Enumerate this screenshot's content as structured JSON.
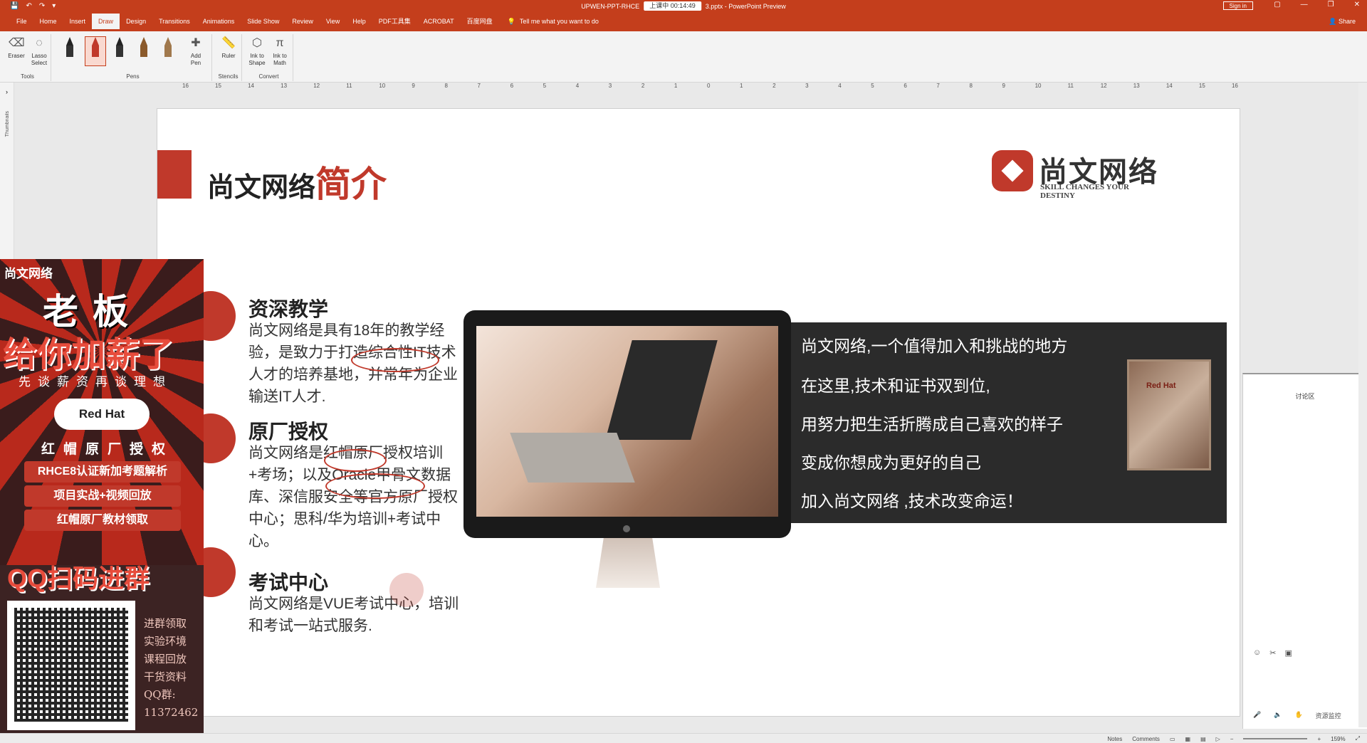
{
  "titlebar": {
    "title_left": "UPWEN-PPT-RHCE",
    "timer": "上课中 00:14:49",
    "title_right": "3.pptx - PowerPoint Preview",
    "signin": "Sign in"
  },
  "menu": {
    "tabs": [
      "File",
      "Home",
      "Insert",
      "Draw",
      "Design",
      "Transitions",
      "Animations",
      "Slide Show",
      "Review",
      "View",
      "Help",
      "PDF工具集",
      "ACROBAT",
      "百度网盘"
    ],
    "active": "Draw",
    "tellme": "Tell me what you want to do",
    "share": "Share"
  },
  "ribbon": {
    "eraser": "Eraser",
    "lasso": "Lasso Select",
    "tools_group": "Tools",
    "add_pen": "Add Pen",
    "pens_group": "Pens",
    "ruler": "Ruler",
    "stencils_group": "Stencils",
    "ink_shape": "Ink to Shape",
    "ink_math": "Ink to Math",
    "convert_group": "Convert"
  },
  "ruler": {
    "ticks": [
      "16",
      "15",
      "14",
      "13",
      "12",
      "11",
      "10",
      "9",
      "8",
      "7",
      "6",
      "5",
      "4",
      "3",
      "2",
      "1",
      "0",
      "1",
      "2",
      "3",
      "4",
      "5",
      "6",
      "7",
      "8",
      "9",
      "10",
      "11",
      "12",
      "13",
      "14",
      "15",
      "16"
    ]
  },
  "thumbnails_label": "Thumbnails",
  "slide": {
    "title_main": "尚文网络",
    "title_highlight": "简介",
    "logo_name": "尚文网络",
    "logo_sub": "SKILL CHANGES YOUR DESTINY",
    "sections": [
      {
        "title": "资深教学",
        "body": "尚文网络是具有18年的教学经验，是致力于打造综合性IT技术人才的培养基地，并常年为企业输送IT人才."
      },
      {
        "title": "原厂授权",
        "body": "尚文网络是红帽原厂授权培训+考场；以及Oracle甲骨文数据库、深信服安全等官方原厂授权中心；思科/华为培训+考试中心。"
      },
      {
        "title": "考试中心",
        "body": "尚文网络是VUE考试中心，培训和考试一站式服务."
      }
    ],
    "panel_lines": [
      "尚文网络,一个值得加入和挑战的地方",
      "在这里,技术和证书双到位,",
      "用努力把生活折腾成自己喜欢的样子",
      "变成你想成为更好的自己",
      "加入尚文网络 ,技术改变命运！"
    ],
    "plaque_text": "Red Hat"
  },
  "ad": {
    "brand": "尚文网络",
    "big1": "老板",
    "big2": "给你加薪了",
    "tag1": "先谈薪资再谈理想",
    "redhat": "Red Hat",
    "tag2": "红帽原厂授权",
    "bullets": [
      "RHCE8认证新加考题解析",
      "项目实战+视频回放",
      "红帽原厂教材领取"
    ],
    "qq_banner": "QQ扫码进群",
    "side_lines": [
      "进群领取",
      "实验环境",
      "课程回放",
      "干货资料",
      "QQ群:",
      "11372462"
    ]
  },
  "discussion": {
    "title": "讨论区",
    "bottom": [
      "资源监控"
    ]
  },
  "status": {
    "notes": "Notes",
    "comments": "Comments",
    "zoom": "159%"
  }
}
